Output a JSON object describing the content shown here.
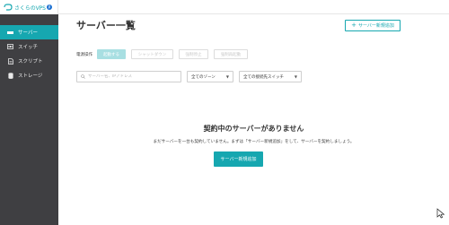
{
  "app": {
    "logo_text": "さくらのVPS",
    "logo_badge": "β"
  },
  "sidebar": {
    "items": [
      {
        "label": "サーバー",
        "icon": "server-rack-icon"
      },
      {
        "label": "スイッチ",
        "icon": "switch-icon"
      },
      {
        "label": "スクリプト",
        "icon": "script-document-icon"
      },
      {
        "label": "ストレージ",
        "icon": "storage-database-icon"
      }
    ]
  },
  "header": {
    "title": "サーバー一覧",
    "add_button": "サーバー新規追加"
  },
  "power": {
    "label": "電源操作",
    "start": "起動する",
    "shutdown": "シャットダウン",
    "force_stop": "強制停止",
    "force_reboot": "強制再起動"
  },
  "filters": {
    "search_placeholder": "サーバー名、IPアドレス",
    "zone_value": "全てのゾーン",
    "switch_value": "全ての接続先スイッチ"
  },
  "empty": {
    "title": "契約中のサーバーがありません",
    "description": "まだサーバーを一台も契約していません。まずは「サーバー新規追加」をして、サーバーを契約しましょう。",
    "cta": "サーバー新規追加"
  },
  "colors": {
    "accent": "#16a7b0",
    "sidebar_bg": "#3f3f42"
  }
}
